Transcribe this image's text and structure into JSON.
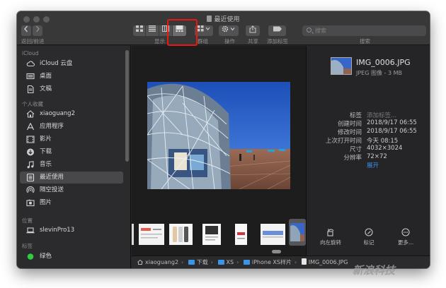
{
  "window": {
    "title": "最近使用"
  },
  "toolbar": {
    "back_forward_label": "返回/前进",
    "display_label": "显示",
    "group_label": "群组",
    "action_label": "操作",
    "share_label": "共享",
    "tag_label": "添加标签",
    "search_label": "搜索",
    "search_placeholder": "搜索",
    "active_view": "gallery"
  },
  "sidebar": {
    "sections": [
      {
        "heading": "iCloud",
        "items": [
          {
            "label": "iCloud 云盘",
            "icon": "cloud-icon"
          },
          {
            "label": "桌面",
            "icon": "desktop-icon"
          },
          {
            "label": "文稿",
            "icon": "document-icon"
          }
        ]
      },
      {
        "heading": "个人收藏",
        "items": [
          {
            "label": "xiaoguang2",
            "icon": "home-icon"
          },
          {
            "label": "应用程序",
            "icon": "applications-icon"
          },
          {
            "label": "影片",
            "icon": "movie-icon"
          },
          {
            "label": "下载",
            "icon": "download-icon"
          },
          {
            "label": "音乐",
            "icon": "music-icon"
          },
          {
            "label": "最近使用",
            "icon": "recents-icon",
            "selected": true
          },
          {
            "label": "隔空投送",
            "icon": "airdrop-icon"
          },
          {
            "label": "图片",
            "icon": "pictures-icon"
          }
        ]
      },
      {
        "heading": "位置",
        "items": [
          {
            "label": "slevinPro13",
            "icon": "laptop-icon"
          }
        ]
      },
      {
        "heading": "标签",
        "items": [
          {
            "label": "绿色",
            "icon": "green-tag-icon",
            "color": "#2ecc40"
          }
        ]
      }
    ]
  },
  "preview": {
    "file_name": "IMG_0006.JPG",
    "file_type": "JPEG 图像 - 3 MB",
    "metadata": [
      {
        "key": "标签",
        "value": "添加标签...",
        "placeholder": true
      },
      {
        "key": "创建时间",
        "value": "2018/9/17 06:55"
      },
      {
        "key": "修改时间",
        "value": "2018/9/17 06:55"
      },
      {
        "key": "上次打开时间",
        "value": "今天 08:15"
      },
      {
        "key": "尺寸",
        "value": "4032×3024"
      },
      {
        "key": "分辨率",
        "value": "72×72"
      }
    ],
    "show_more": "展开",
    "actions": {
      "rotate_left": "向左旋转",
      "markup": "标记",
      "more": "更多..."
    }
  },
  "pathbar": {
    "crumbs": [
      "xiaoguang2",
      "下载",
      "XS",
      "iPhone XS样片",
      "IMG_0006.JPG"
    ]
  },
  "watermark": {
    "text": "新浪科技"
  },
  "colors": {
    "highlight": "#e8190f",
    "accent_link": "#3a8cf0",
    "folder": "#3a95e8"
  }
}
